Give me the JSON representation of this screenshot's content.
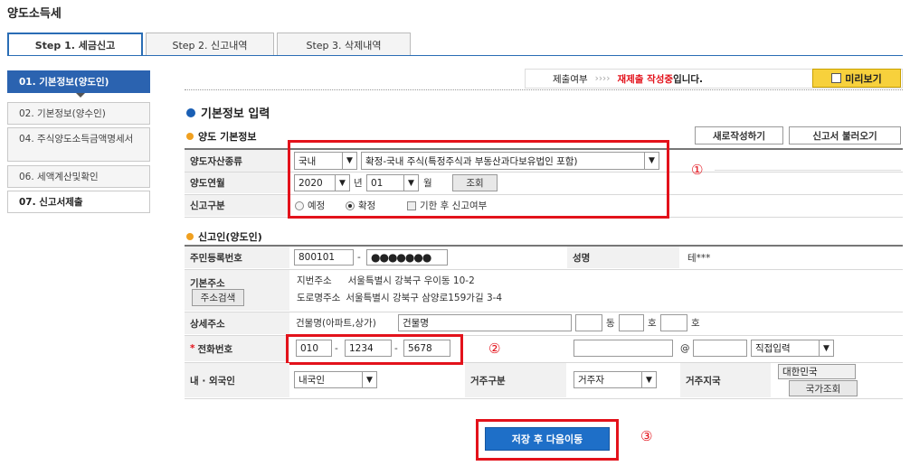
{
  "page": {
    "title": "양도소득세"
  },
  "tabs": [
    {
      "label": "Step 1. 세금신고"
    },
    {
      "label": "Step 2. 신고내역"
    },
    {
      "label": "Step 3. 삭제내역"
    }
  ],
  "sidebar": {
    "items": [
      {
        "label": "01. 기본정보(양도인)"
      },
      {
        "label": "02. 기본정보(양수인)"
      },
      {
        "label": "04. 주식양도소득금액명세서"
      },
      {
        "label": "06. 세액계산및확인"
      },
      {
        "label": "07. 신고서제출"
      }
    ]
  },
  "status": {
    "prefix": "제출여부",
    "arrows": "››››",
    "highlight": "재제출 작성중",
    "suffix": "입니다.",
    "preview_label": "미리보기"
  },
  "section": {
    "title": "기본정보 입력"
  },
  "transfer": {
    "title": "양도 기본정보",
    "new_button": "새로작성하기",
    "load_button": "신고서 불러오기",
    "asset_type_label": "양도자산종류",
    "asset_region": "국내",
    "asset_kind": "확정-국내 주식(특정주식과 부동산과다보유법인 포함)",
    "date_label": "양도연월",
    "year": "2020",
    "year_unit": "년",
    "month": "01",
    "month_unit": "월",
    "lookup_button": "조회",
    "report_type_label": "신고구분",
    "option_prelim": "예정",
    "option_final": "확정",
    "option_late": "기한 후 신고여부"
  },
  "reporter": {
    "title": "신고인(양도인)",
    "rrn_label": "주민등록번호",
    "rrn_front": "800101",
    "rrn_sep": "-",
    "rrn_back": "●●●●●●●",
    "name_label": "성명",
    "name_value": "테***",
    "address_label": "기본주소",
    "address_button": "주소검색",
    "lot_label": "지번주소",
    "lot_value": "서울특별시 강북구 우이동 10-2",
    "road_label": "도로명주소",
    "road_value": "서울특별시 강북구 삼양로159가길 3-4",
    "detail_label": "상세주소",
    "building_label": "건물명(아파트,상가)",
    "building_value": "건물명",
    "dong_unit": "동",
    "ho_unit": "호",
    "phone_label": "전화번호",
    "phone_required": "*",
    "phone1": "010",
    "phone2": "1234",
    "phone3": "5678",
    "phone_sep": "-",
    "email_at": "@",
    "email_domain_select": "직접입력",
    "nationality_label": "내 · 외국인",
    "nationality_value": "내국인",
    "residency_label": "거주구분",
    "residency_value": "거주자",
    "country_label": "거주지국",
    "country_value": "대한민국",
    "country_button": "국가조회"
  },
  "footer": {
    "save_button": "저장 후 다음이동"
  },
  "annotations": {
    "one": "①",
    "two": "②",
    "three": "③"
  },
  "colors": {
    "accent": "#2b63b0",
    "annotation_red": "#e3121b",
    "preview_yellow": "#f7d13c"
  }
}
